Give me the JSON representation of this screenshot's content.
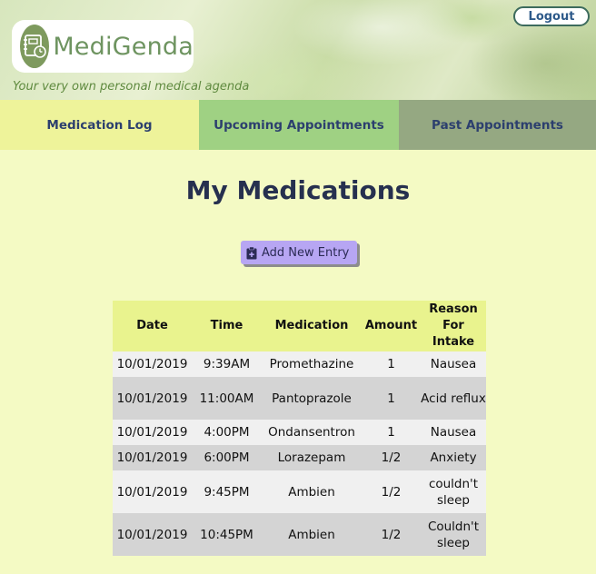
{
  "header": {
    "brand": "MediGenda",
    "tagline": "Your very own personal medical agenda",
    "logout_label": "Logout"
  },
  "nav": {
    "tabs": [
      {
        "label": "Medication Log"
      },
      {
        "label": "Upcoming Appointments"
      },
      {
        "label": "Past Appointments"
      }
    ]
  },
  "main": {
    "title": "My Medications",
    "add_button_label": "Add New Entry",
    "table": {
      "columns": [
        "Date",
        "Time",
        "Medication",
        "Amount",
        "Reason For Intake"
      ],
      "rows": [
        {
          "date": "10/01/2019",
          "time": "9:39AM",
          "medication": "Promethazine",
          "amount": "1",
          "reason": "Nausea"
        },
        {
          "date": "10/01/2019",
          "time": "11:00AM",
          "medication": "Pantoprazole",
          "amount": "1",
          "reason": "Acid reflux"
        },
        {
          "date": "10/01/2019",
          "time": "4:00PM",
          "medication": "Ondansentron",
          "amount": "1",
          "reason": "Nausea"
        },
        {
          "date": "10/01/2019",
          "time": "6:00PM",
          "medication": "Lorazepam",
          "amount": "1/2",
          "reason": "Anxiety"
        },
        {
          "date": "10/01/2019",
          "time": "9:45PM",
          "medication": "Ambien",
          "amount": "1/2",
          "reason": "couldn't sleep"
        },
        {
          "date": "10/01/2019",
          "time": "10:45PM",
          "medication": "Ambien",
          "amount": "1/2",
          "reason": "Couldn't sleep"
        }
      ]
    }
  },
  "colors": {
    "page_bg": "#f4fac4",
    "tab_medication_log": "#eef39a",
    "tab_upcoming": "#9fd183",
    "tab_past": "#95a882",
    "add_button": "#b7a6f3",
    "table_header": "#e9f38e",
    "row_light": "#f0f0f0",
    "row_dark": "#d4d4d4"
  },
  "icons": {
    "logo": "notebook-clock-icon",
    "add_entry": "clipboard-plus-icon"
  }
}
